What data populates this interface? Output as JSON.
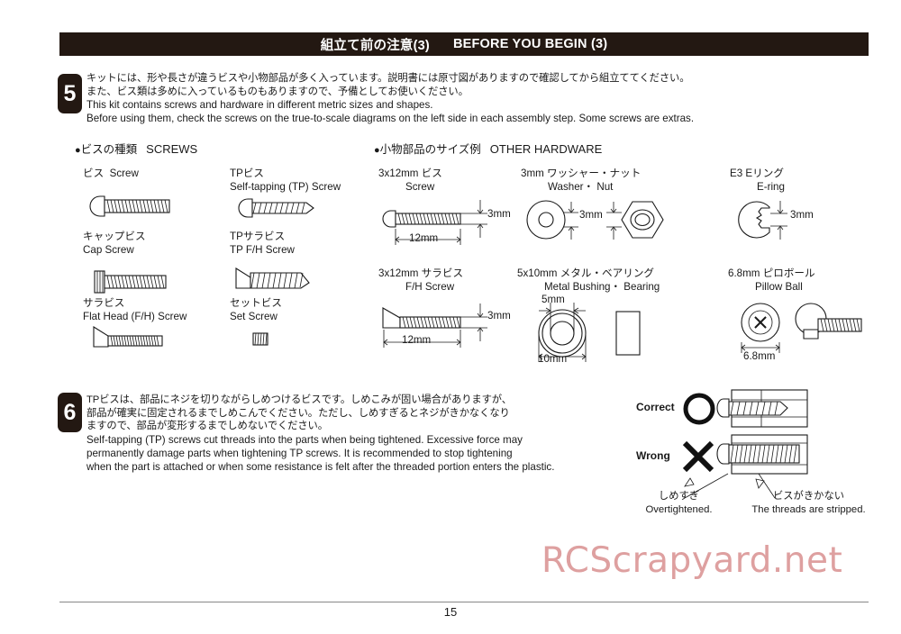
{
  "banner": {
    "jp_title": "組立て前の注意(3)",
    "en_title": "BEFORE YOU BEGIN (3)"
  },
  "steps": [
    {
      "number": "5",
      "jp_lines": [
        "キットには、形や長さが違うビスや小物部品が多く入っています。説明書には原寸図がありますので確認してから組立ててください。",
        "また、ビス類は多めに入っているものもありますので、予備としてお使いください。"
      ],
      "en_lines": [
        "This kit contains screws and hardware in different metric sizes and shapes.",
        "Before using them, check the screws on the true-to-scale diagrams on the left side in each assembly step.  Some screws are extras."
      ]
    },
    {
      "number": "6",
      "jp_lines": [
        "TPビスは、部品にネジを切りながらしめつけるビスです。しめこみが固い場合がありますが、",
        "部品が確実に固定されるまでしめこんでください。ただし、しめすぎるとネジがきかなくなり",
        "ますので、部品が変形するまでしめないでください。"
      ],
      "en_lines": [
        "Self-tapping (TP) screws cut threads into the parts when being tightened.  Excessive force may",
        "permanently damage parts when tightening TP screws.  It is recommended to stop tightening",
        "when the part is attached or when some resistance is felt after the threaded portion enters the plastic."
      ]
    }
  ],
  "sections": {
    "screws": {
      "bullet": "●",
      "jp": "ビスの種類",
      "en": "SCREWS"
    },
    "hardware": {
      "bullet": "●",
      "jp": "小物部品のサイズ例",
      "en": "OTHER HARDWARE"
    }
  },
  "screw_types": [
    {
      "jp": "ビス",
      "en": "Screw",
      "inline": true
    },
    {
      "jp": "キャップビス",
      "en": "Cap Screw"
    },
    {
      "jp": "サラビス",
      "en": "Flat Head (F/H) Screw"
    },
    {
      "jp": "TPビス",
      "en": "Self-tapping (TP) Screw"
    },
    {
      "jp": "TPサラビス",
      "en": "TP F/H Screw"
    },
    {
      "jp": "セットビス",
      "en": "Set Screw"
    }
  ],
  "hardware": [
    {
      "jp": "3x12mm ビス",
      "en": "Screw",
      "dims": {
        "height": "3mm",
        "length": "12mm"
      }
    },
    {
      "jp": "3x12mm サラビス",
      "en": "F/H Screw",
      "dims": {
        "height": "3mm",
        "length": "12mm"
      }
    },
    {
      "jp": "3mm ワッシャー・ナット",
      "en": "Washer・ Nut",
      "dims": {
        "bore": "3mm"
      }
    },
    {
      "jp": "5x10mm メタル・ベアリング",
      "en": "Metal Bushing・ Bearing",
      "dims": {
        "bore": "5mm",
        "outer": "10mm"
      }
    },
    {
      "jp": "E3 Eリング",
      "en": "E-ring",
      "dims": {
        "bore": "3mm"
      }
    },
    {
      "jp": "6.8mm ピロボール",
      "en": "Pillow Ball",
      "dims": {
        "diameter": "6.8mm"
      }
    }
  ],
  "correct_wrong": {
    "correct_label": "Correct",
    "wrong_label": "Wrong",
    "callout_left": {
      "jp": "しめすぎ",
      "en": "Overtightened."
    },
    "callout_right": {
      "jp": "ビスがきかない",
      "en": "The threads are stripped."
    }
  },
  "watermark": "RCScrapyard.net",
  "footer": {
    "page_number": "15"
  },
  "colors": {
    "banner_bg": "#231812",
    "ink": "#1a1a1a",
    "watermark": "#dea0a0",
    "rule": "#888888"
  }
}
